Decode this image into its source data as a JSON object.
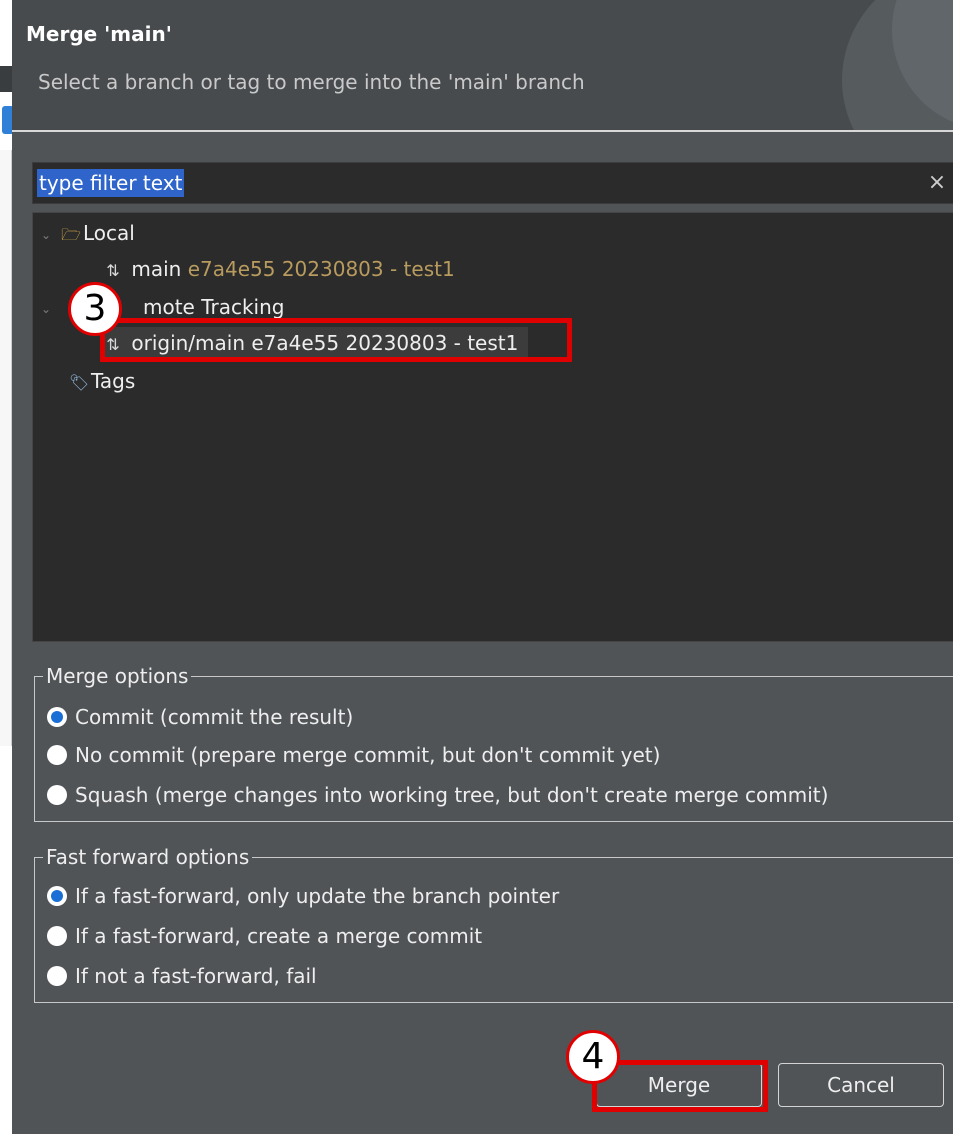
{
  "dialog": {
    "title": "Merge 'main'",
    "subtitle": "Select a branch or tag to merge into the 'main' branch"
  },
  "filter": {
    "value": "type filter text",
    "clear_icon": "×"
  },
  "tree": {
    "local": {
      "label": "Local",
      "branch_name": "main",
      "branch_meta": "e7a4e55 20230803 - test1"
    },
    "remote": {
      "label": "mote Tracking",
      "branch": "origin/main e7a4e55 20230803 - test1"
    },
    "tags": {
      "label": "Tags"
    },
    "icons": {
      "chevron": "⌄",
      "folder": "🗁",
      "branch": "⇅",
      "tags": "🏷"
    }
  },
  "merge_options": {
    "legend": "Merge options",
    "options": [
      {
        "label": "Commit (commit the result)",
        "checked": true
      },
      {
        "label": "No commit (prepare merge commit, but don't commit yet)",
        "checked": false
      },
      {
        "label": "Squash (merge changes into working tree, but don't create merge commit)",
        "checked": false
      }
    ]
  },
  "fast_forward_options": {
    "legend": "Fast forward options",
    "options": [
      {
        "label": "If a fast-forward, only update the branch pointer",
        "checked": true
      },
      {
        "label": "If a fast-forward, create a merge commit",
        "checked": false
      },
      {
        "label": "If not a fast-forward, fail",
        "checked": false
      }
    ]
  },
  "buttons": {
    "merge": "Merge",
    "cancel": "Cancel"
  },
  "annotations": {
    "step_remote": "3",
    "step_merge": "4",
    "color": "#e00000"
  },
  "colors": {
    "dialog_bg": "#505457",
    "tree_bg": "#2b2b2b",
    "selection_blue": "#2f65ca",
    "meta_text": "#b89b5e"
  }
}
